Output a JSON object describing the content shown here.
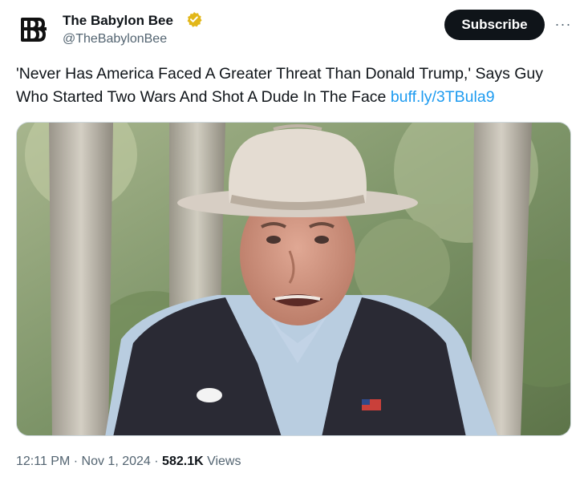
{
  "author": {
    "name": "The Babylon Bee",
    "handle": "@TheBabylonBee",
    "verified_icon": "gold-verified-badge-icon",
    "avatar_icon": "babylon-bee-logo-icon"
  },
  "actions": {
    "subscribe_label": "Subscribe",
    "more_icon": "more-horizontal-icon",
    "more_label": "···"
  },
  "tweet": {
    "text": "'Never Has America Faced A Greater Threat Than Donald Trump,' Says Guy Who Started Two Wars And Shot A Dude In The Face",
    "link": "buff.ly/3TBula9"
  },
  "media": {
    "type": "photo"
  },
  "meta": {
    "time": "12:11 PM",
    "separator": "·",
    "date": "Nov 1, 2024",
    "views_count": "582.1K",
    "views_label": "Views"
  },
  "colors": {
    "text": "#0f1419",
    "secondary": "#536471",
    "link": "#1d9bf0",
    "verified_gold": "#e2b719",
    "button_bg": "#0f1419"
  }
}
